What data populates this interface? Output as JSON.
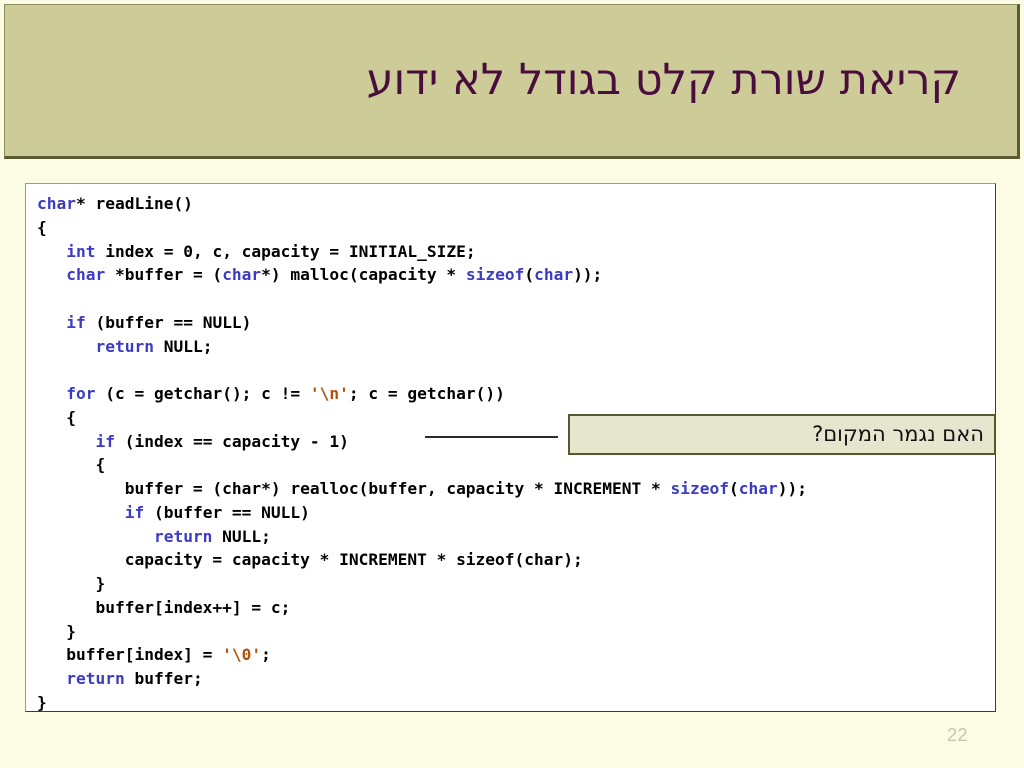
{
  "slide": {
    "title": "קריאת שורת קלט בגודל לא ידוע",
    "page_number": "22",
    "colors": {
      "title_band": "#CDCC99",
      "title_band_border": "#5B5B33",
      "title_text": "#4A0E3E",
      "slide_background": "#FCFBE3",
      "code_panel_background": "#FFFFFF",
      "code_panel_border": "#3A3A3A",
      "keyword": "#3B3BC4",
      "string_literal": "#B2530B",
      "code_text": "#000000",
      "callout_fill": "#E6E6CF",
      "callout_border": "#58582F",
      "page_number": "#C6C6B0"
    }
  },
  "code": {
    "language": "c",
    "full_text": "char* readLine()\n{\n   int index = 0, c, capacity = INITIAL_SIZE;\n   char *buffer = (char*) malloc(capacity * sizeof(char));\n\n   if (buffer == NULL)\n      return NULL;\n\n   for (c = getchar(); c != '\\n'; c = getchar())\n   {\n      if (index == capacity - 1)\n      {\n         buffer = (char*) realloc(buffer, capacity * INCREMENT * sizeof(char));\n         if (buffer == NULL)\n            return NULL;\n         capacity = capacity * INCREMENT * sizeof(char);\n      }\n      buffer[index++] = c;\n   }\n   buffer[index] = '\\0';\n   return buffer;\n}",
    "lines": [
      {
        "n": 1,
        "text": "char* readLine()"
      },
      {
        "n": 2,
        "text": "{"
      },
      {
        "n": 3,
        "text": "   int index = 0, c, capacity = INITIAL_SIZE;"
      },
      {
        "n": 4,
        "text": "   char *buffer = (char*) malloc(capacity * sizeof(char));"
      },
      {
        "n": 5,
        "text": ""
      },
      {
        "n": 6,
        "text": "   if (buffer == NULL)"
      },
      {
        "n": 7,
        "text": "      return NULL;"
      },
      {
        "n": 8,
        "text": ""
      },
      {
        "n": 9,
        "text": "   for (c = getchar(); c != '\\n'; c = getchar())"
      },
      {
        "n": 10,
        "text": "   {"
      },
      {
        "n": 11,
        "text": "      if (index == capacity - 1)"
      },
      {
        "n": 12,
        "text": "      {"
      },
      {
        "n": 13,
        "text": "         buffer = (char*) realloc(buffer, capacity * INCREMENT * sizeof(char));"
      },
      {
        "n": 14,
        "text": "         if (buffer == NULL)"
      },
      {
        "n": 15,
        "text": "            return NULL;"
      },
      {
        "n": 16,
        "text": "         capacity = capacity * INCREMENT * sizeof(char);"
      },
      {
        "n": 17,
        "text": "      }"
      },
      {
        "n": 18,
        "text": "      buffer[index++] = c;"
      },
      {
        "n": 19,
        "text": "   }"
      },
      {
        "n": 20,
        "text": "   buffer[index] = '\\0';"
      },
      {
        "n": 21,
        "text": "   return buffer;"
      },
      {
        "n": 22,
        "text": "}"
      }
    ]
  },
  "callout": {
    "text": "האם נגמר המקום?",
    "points_to_line": 11
  }
}
